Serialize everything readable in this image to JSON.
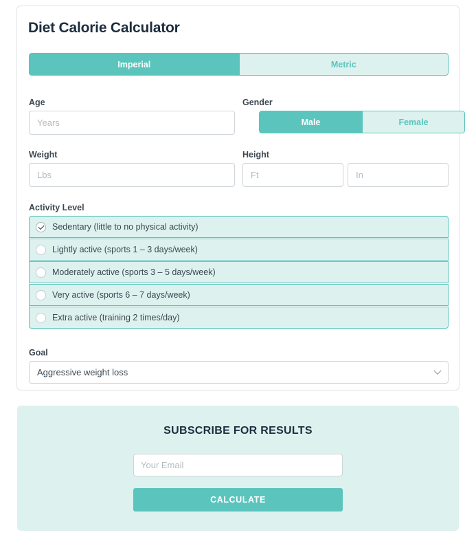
{
  "card": {
    "title": "Diet Calorie Calculator",
    "unit_toggle": {
      "imperial_label": "Imperial",
      "metric_label": "Metric",
      "selected": "Imperial"
    },
    "age": {
      "label": "Age",
      "placeholder": "Years",
      "value": ""
    },
    "gender": {
      "label": "Gender",
      "male_label": "Male",
      "female_label": "Female",
      "selected": "Male"
    },
    "weight": {
      "label": "Weight",
      "placeholder": "Lbs",
      "value": ""
    },
    "height": {
      "label": "Height",
      "feet_placeholder": "Ft",
      "feet_value": "",
      "inches_placeholder": "In",
      "inches_value": ""
    },
    "activity": {
      "label": "Activity Level",
      "selected_index": 0,
      "options": [
        {
          "label": "Sedentary (little to no physical activity)",
          "selected": true
        },
        {
          "label": "Lightly active (sports 1 – 3 days/week)",
          "selected": false
        },
        {
          "label": "Moderately active (sports 3 – 5 days/week)",
          "selected": false
        },
        {
          "label": "Very active (sports 6 – 7 days/week)",
          "selected": false
        },
        {
          "label": "Extra active (training 2 times/day)",
          "selected": false
        }
      ]
    },
    "goal": {
      "label": "Goal",
      "selected": "Aggressive weight loss",
      "icon": "chevron-down-icon"
    }
  },
  "subscribe": {
    "title": "SUBSCRIBE FOR RESULTS",
    "email_placeholder": "Your Email",
    "email_value": "",
    "calculate_label": "CALCULATE"
  },
  "colors": {
    "accent_teal": "#5bc4bd",
    "accent_mint": "#ddf1ee",
    "text_dark": "#1d2d3e",
    "text_body": "#3d4852",
    "placeholder": "#b4bcc2",
    "border_gray": "#cfd4d8"
  }
}
